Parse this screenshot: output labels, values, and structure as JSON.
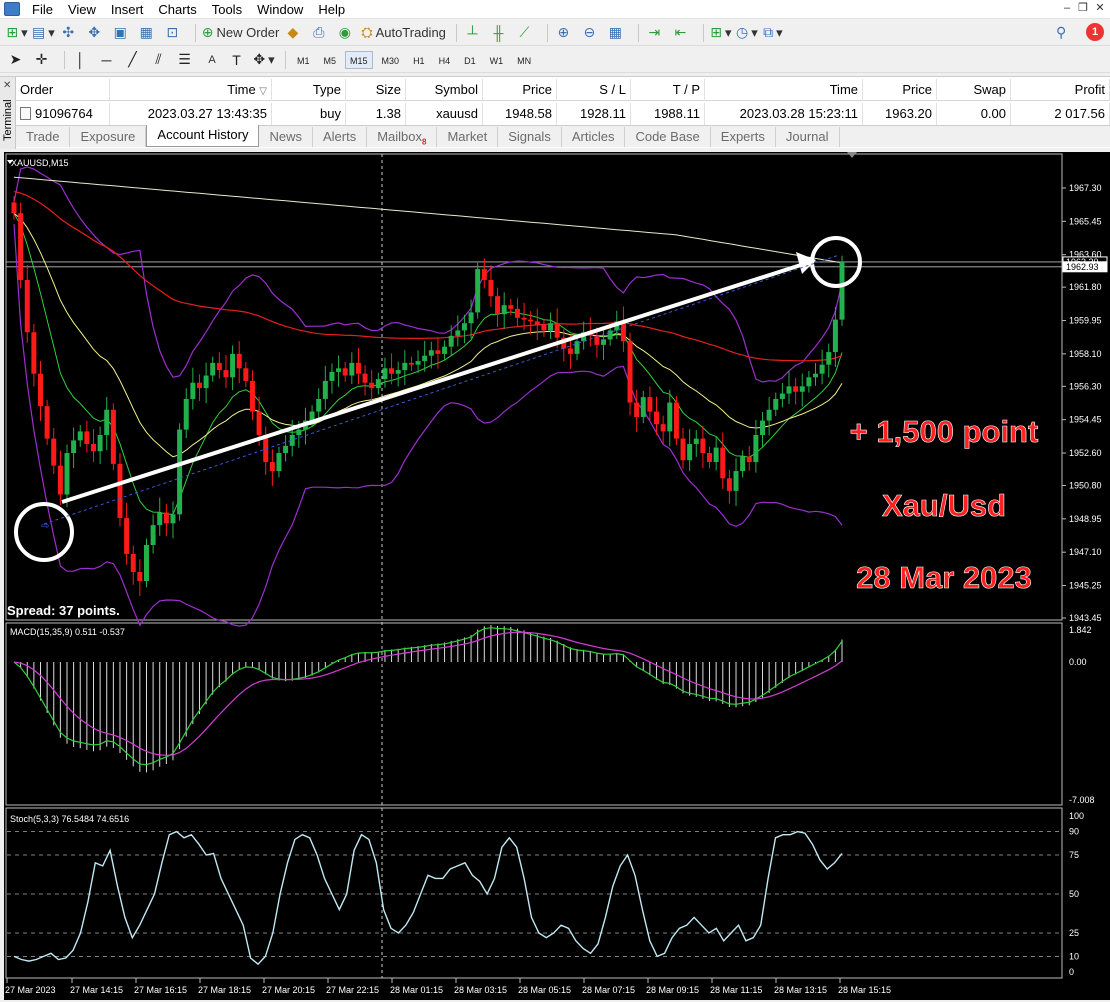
{
  "menu": [
    "File",
    "View",
    "Insert",
    "Charts",
    "Tools",
    "Window",
    "Help"
  ],
  "toolbar": {
    "new_order": "New Order",
    "autotrading": "AutoTrading",
    "timeframes": [
      "M1",
      "M5",
      "M15",
      "M30",
      "H1",
      "H4",
      "D1",
      "W1",
      "MN"
    ],
    "active_timeframe": "M15",
    "notification_count": "1"
  },
  "terminal": {
    "label": "Terminal",
    "columns": [
      "Order",
      "Time",
      "Type",
      "Size",
      "Symbol",
      "Price",
      "S / L",
      "T / P",
      "Time",
      "Price",
      "Swap",
      "Profit"
    ],
    "rows": [
      [
        "91096764",
        "2023.03.27 13:43:35",
        "buy",
        "1.38",
        "xauusd",
        "1948.58",
        "1928.11",
        "1988.11",
        "2023.03.28 15:23:11",
        "1963.20",
        "0.00",
        "2 017.56"
      ]
    ],
    "tabs": [
      "Trade",
      "Exposure",
      "Account History",
      "News",
      "Alerts",
      "Mailbox",
      "Market",
      "Signals",
      "Articles",
      "Code Base",
      "Experts",
      "Journal"
    ],
    "active_tab": "Account History",
    "mailbox_badge": "8"
  },
  "chart": {
    "symbol_label": "XAUUSD,M15",
    "spread_label": "Spread: 37 points.",
    "price_labels": [
      "1967.30",
      "1965.45",
      "1963.60",
      "1961.80",
      "1959.95",
      "1958.10",
      "1956.30",
      "1954.45",
      "1952.60",
      "1950.80",
      "1948.95",
      "1947.10",
      "1945.25",
      "1943.45"
    ],
    "current_price_1": "1963.20",
    "current_price_2": "1962.93",
    "macd_label": "MACD(15,35,9) 0.511 -0.537",
    "macd_scale": [
      "1.842",
      "0.00",
      "-7.008"
    ],
    "stoch_label": "Stoch(5,3,3) 76.5484 74.6516",
    "stoch_scale": [
      "100",
      "90",
      "75",
      "50",
      "25",
      "10",
      "0"
    ],
    "time_labels": [
      "27 Mar 2023",
      "27 Mar 14:15",
      "27 Mar 16:15",
      "27 Mar 18:15",
      "27 Mar 20:15",
      "27 Mar 22:15",
      "28 Mar 01:15",
      "28 Mar 03:15",
      "28 Mar 05:15",
      "28 Mar 07:15",
      "28 Mar 09:15",
      "28 Mar 11:15",
      "28 Mar 13:15",
      "28 Mar 15:15"
    ],
    "annotation_1": "+ 1,500 point",
    "annotation_2": "Xau/Usd",
    "annotation_3": "28 Mar 2023",
    "colors": {
      "bull": "#22b14c",
      "bear": "#ff1a1a",
      "background": "#000000",
      "annotation": "#ff2020"
    }
  }
}
